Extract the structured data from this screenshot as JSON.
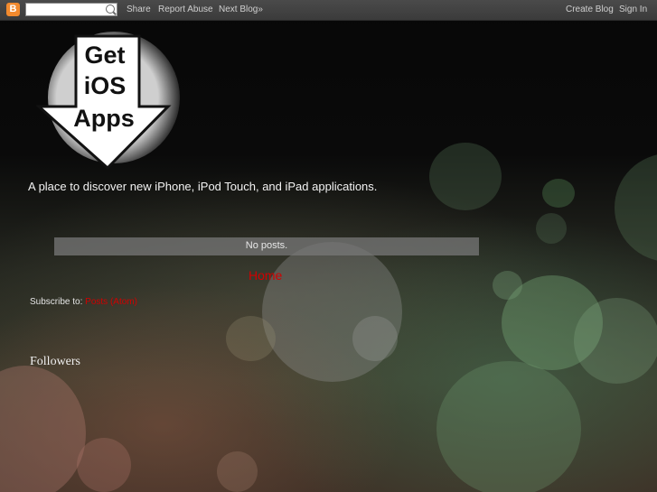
{
  "navbar": {
    "logo_letter": "B",
    "search_value": "",
    "search_placeholder": "",
    "share": "Share",
    "report_abuse": "Report Abuse",
    "next_blog": "Next Blog»",
    "create_blog": "Create Blog",
    "sign_in": "Sign In"
  },
  "header": {
    "logo_lines": [
      "Get",
      "iOS",
      "Apps"
    ],
    "tagline": "A place to discover new iPhone, iPod Touch, and iPad applications."
  },
  "main": {
    "status": "No posts.",
    "home_link": "Home",
    "subscribe_label": "Subscribe to: ",
    "subscribe_link": "Posts (Atom)"
  },
  "sidebar": {
    "followers_title": "Followers"
  },
  "colors": {
    "link": "#d10000",
    "navbar": "#444444",
    "blogger_orange": "#f28a2e"
  }
}
